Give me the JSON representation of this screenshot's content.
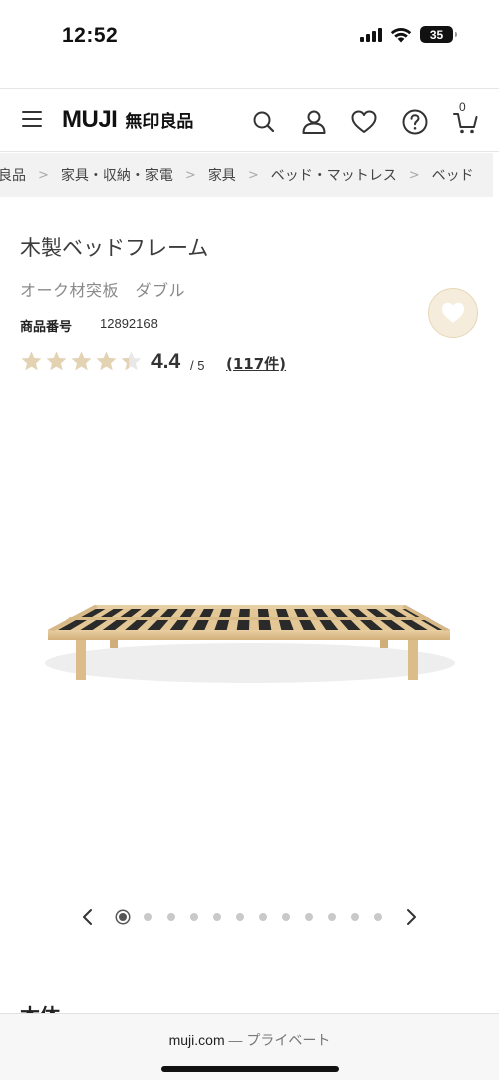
{
  "status_bar": {
    "time": "12:52",
    "battery": "35"
  },
  "header": {
    "logo_latin": "MUJI",
    "logo_kanji": "無印良品",
    "cart_count": "0"
  },
  "breadcrumb": [
    "良品",
    "家具・収納・家電",
    "家具",
    "ベッド・マットレス",
    "ベッド"
  ],
  "product": {
    "title": "木製ベッドフレーム",
    "subtitle": "オーク材突板　ダブル",
    "item_number_label": "商品番号",
    "item_number": "12892168",
    "rating": 4.4,
    "rating_text": "4.4",
    "rating_max": "/ 5",
    "review_count": "(117件)"
  },
  "carousel": {
    "total": 12,
    "active_index": 0
  },
  "section_heading": "本体",
  "browser": {
    "domain": "muji.com",
    "privacy": " — プライベート"
  },
  "colors": {
    "star": "#e3d3b3",
    "star_empty": "#e8e8e8",
    "fav_bg": "#f5ecdc",
    "breadcrumb_bg": "#f2f2f2"
  }
}
